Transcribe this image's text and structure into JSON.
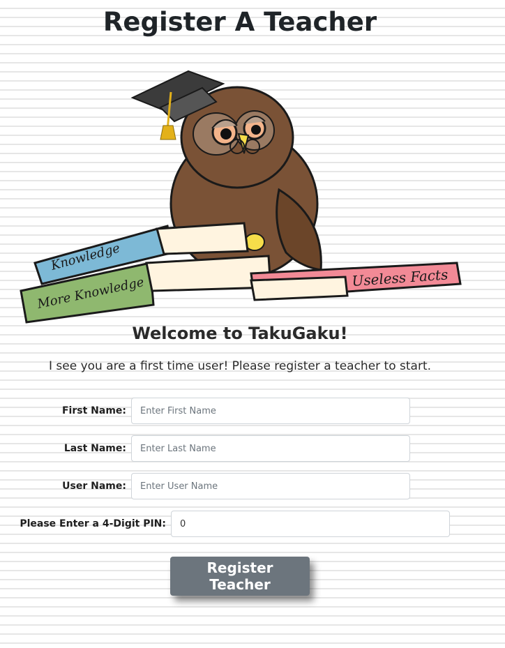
{
  "page": {
    "title": "Register A Teacher",
    "welcome": "Welcome to TakuGaku!",
    "subtitle": "I see you are a first time user! Please register a teacher to start."
  },
  "mascot": {
    "books": {
      "knowledge": "Knowledge",
      "more_knowledge": "More Knowledge",
      "useless_facts": "Useless Facts"
    }
  },
  "form": {
    "first_name": {
      "label": "First Name:",
      "placeholder": "Enter First Name",
      "value": ""
    },
    "last_name": {
      "label": "Last Name:",
      "placeholder": "Enter Last Name",
      "value": ""
    },
    "user_name": {
      "label": "User Name:",
      "placeholder": "Enter User Name",
      "value": ""
    },
    "pin": {
      "label": "Please Enter a 4-Digit PIN:",
      "value": "0"
    },
    "submit_label": "Register Teacher"
  },
  "colors": {
    "button": "#6c757d",
    "owl": "#7a5236",
    "book_blue": "#7db9d6",
    "book_green": "#8fb86f",
    "book_pink": "#f28a96"
  }
}
